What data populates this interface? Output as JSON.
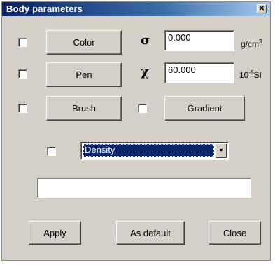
{
  "window": {
    "title": "Body parameters",
    "close_icon": "close-icon"
  },
  "buttons": {
    "color": "Color",
    "pen": "Pen",
    "brush": "Brush",
    "gradient": "Gradient",
    "apply": "Apply",
    "as_default": "As default",
    "close": "Close"
  },
  "density": {
    "symbol": "σ",
    "value": "0.000",
    "unit_main": "g/cm",
    "unit_exp": "3"
  },
  "susceptibility": {
    "symbol": "χ",
    "value": "60.000",
    "unit_prefix": "10",
    "unit_exp": "-5",
    "unit_main": "SI"
  },
  "property_select": {
    "value": "Density",
    "arrow_icon": "chevron-down-icon"
  },
  "text_field": {
    "value": ""
  },
  "checkboxes": {
    "color": false,
    "pen": false,
    "brush": false,
    "gradient": false,
    "property": false
  }
}
